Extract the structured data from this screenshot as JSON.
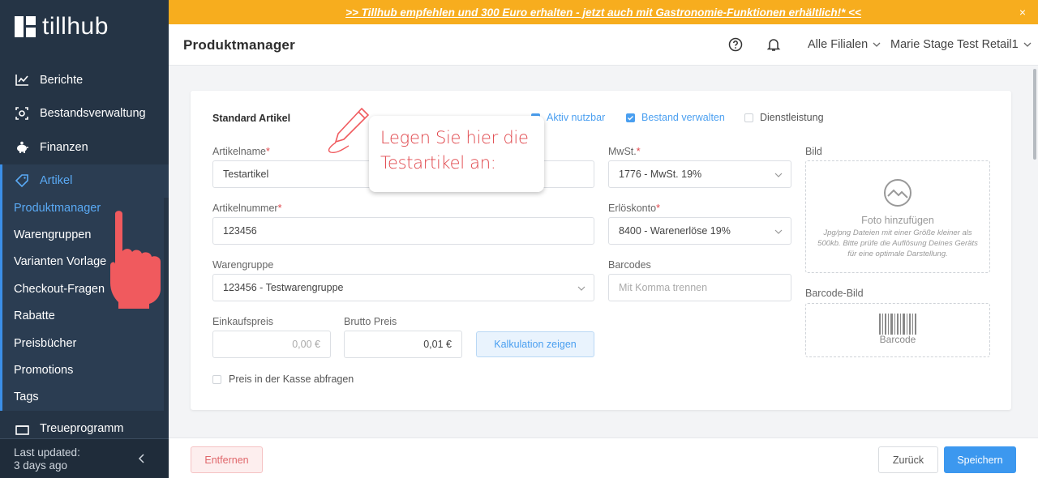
{
  "banner": {
    "text": ">> Tillhub empfehlen und 300 Euro erhalten - jetzt auch mit Gastronomie-Funktionen erhältlich!* <<",
    "close": "×"
  },
  "logo": {
    "text": "tillhub"
  },
  "sidebar": {
    "items": [
      {
        "label": "Berichte",
        "icon": "chart-icon"
      },
      {
        "label": "Bestandsverwaltung",
        "icon": "inventory-icon"
      },
      {
        "label": "Finanzen",
        "icon": "piggy-bank-icon"
      },
      {
        "label": "Artikel",
        "icon": "tag-icon"
      }
    ],
    "subitems": [
      {
        "label": "Produktmanager"
      },
      {
        "label": "Warengruppen"
      },
      {
        "label": "Varianten Vorlage"
      },
      {
        "label": "Checkout-Fragen"
      },
      {
        "label": "Rabatte"
      },
      {
        "label": "Preisbücher"
      },
      {
        "label": "Promotions"
      },
      {
        "label": "Tags"
      }
    ],
    "partial_item": {
      "label": "Treueprogramm",
      "icon": "loyalty-icon"
    },
    "footer": {
      "line1": "Last updated:",
      "line2": "3 days ago"
    }
  },
  "header": {
    "title": "Produktmanager",
    "branch_select": "Alle Filialen",
    "account_select": "Marie Stage Test Retail1"
  },
  "form": {
    "section_title": "Standard Artikel",
    "checkboxes": [
      {
        "label": "Aktiv nutzbar",
        "checked": true
      },
      {
        "label": "Bestand verwalten",
        "checked": true
      },
      {
        "label": "Dienstleistung",
        "checked": false
      }
    ],
    "name": {
      "label": "Artikelname",
      "value": "Testartikel"
    },
    "number": {
      "label": "Artikelnummer",
      "value": "123456"
    },
    "group": {
      "label": "Warengruppe",
      "value": "123456 - Testwarengruppe"
    },
    "purchase_price": {
      "label": "Einkaufspreis",
      "placeholder": "0,00 €"
    },
    "gross_price": {
      "label": "Brutto Preis",
      "value": "0,01 €"
    },
    "calc_button": "Kalkulation zeigen",
    "ask_price": "Preis in der Kasse abfragen",
    "vat": {
      "label": "MwSt.",
      "value": "1776 - MwSt. 19%"
    },
    "revenue_account": {
      "label": "Erlöskonto",
      "value": "8400 - Warenerlöse 19%"
    },
    "barcodes": {
      "label": "Barcodes",
      "placeholder": "Mit Komma trennen"
    },
    "image": {
      "label": "Bild",
      "add": "Foto hinzufügen",
      "hint": "Jpg/png Dateien mit einer Größe kleiner als 500kb. Bitte prüfe die Auflösung Deines Geräts für eine optimale Darstellung."
    },
    "barcode_image": {
      "label": "Barcode-Bild",
      "caption": "Barcode"
    }
  },
  "callout": {
    "line1": "Legen Sie hier die",
    "line2": "Testartikel an:"
  },
  "footer": {
    "remove": "Entfernen",
    "back": "Zurück",
    "save": "Speichern"
  },
  "colors": {
    "sidebar": "#253445",
    "accent": "#3c98ef",
    "banner": "#f7ad1e",
    "danger": "#e0474c",
    "annotation": "#f05a5e"
  }
}
